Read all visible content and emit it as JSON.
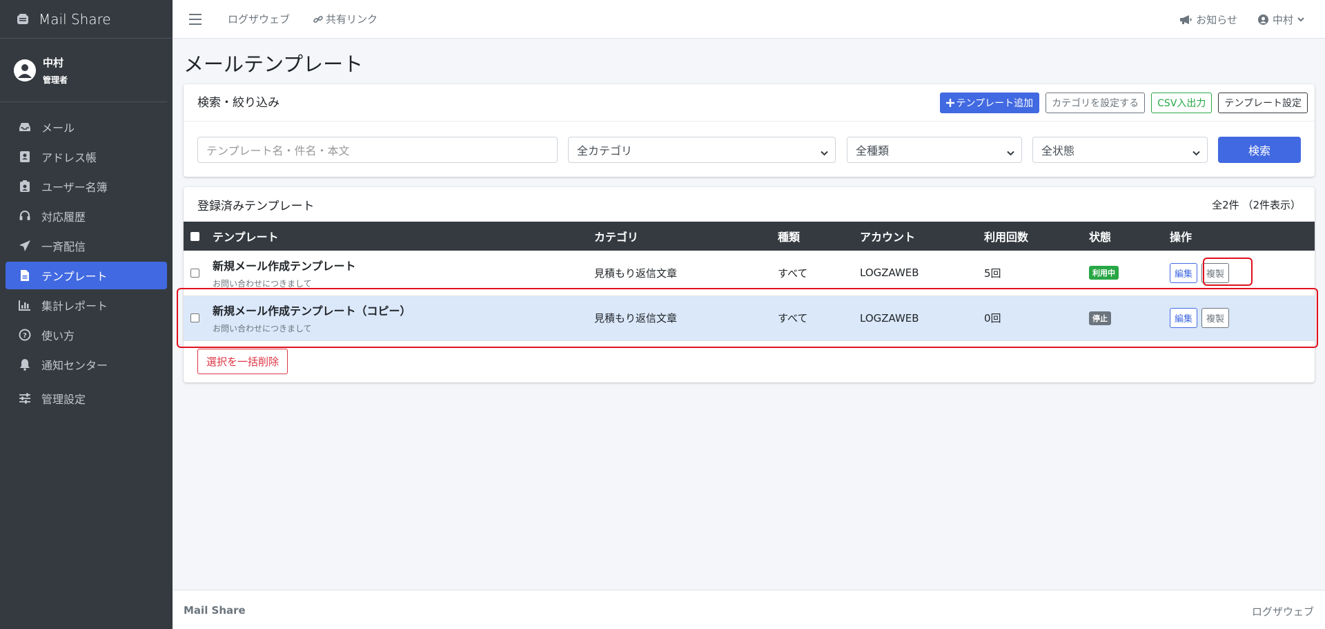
{
  "sidebar": {
    "brand": "Mail Share",
    "user": {
      "name": "中村",
      "role": "管理者"
    },
    "items": [
      {
        "label": "メール",
        "icon": "inbox-icon",
        "active": false
      },
      {
        "label": "アドレス帳",
        "icon": "address-book-icon",
        "active": false
      },
      {
        "label": "ユーザー名簿",
        "icon": "id-badge-icon",
        "active": false
      },
      {
        "label": "対応履歴",
        "icon": "headset-icon",
        "active": false
      },
      {
        "label": "一斉配信",
        "icon": "paper-plane-icon",
        "active": false
      },
      {
        "label": "テンプレート",
        "icon": "file-icon",
        "active": true
      },
      {
        "label": "集計レポート",
        "icon": "chart-bar-icon",
        "active": false
      },
      {
        "label": "使い方",
        "icon": "question-circle-icon",
        "active": false
      },
      {
        "label": "通知センター",
        "icon": "bell-icon",
        "active": false
      },
      {
        "label": "管理設定",
        "icon": "sliders-icon",
        "active": false
      }
    ]
  },
  "header": {
    "links": [
      "ログザウェブ",
      "共有リンク"
    ],
    "notice": "お知らせ",
    "user": "中村"
  },
  "page": {
    "title": "メールテンプレート"
  },
  "search": {
    "title": "検索・絞り込み",
    "buttons": {
      "add": "テンプレート追加",
      "category": "カテゴリを設定する",
      "csv": "CSV入出力",
      "settings": "テンプレート設定"
    },
    "placeholder": "テンプレート名・件名・本文",
    "category_select": "全カテゴリ",
    "type_select": "全種類",
    "status_select": "全状態",
    "submit": "検索"
  },
  "list": {
    "title": "登録済みテンプレート",
    "count": "全2件 （2件表示）",
    "columns": [
      "テンプレート",
      "カテゴリ",
      "種類",
      "アカウント",
      "利用回数",
      "状態",
      "操作"
    ],
    "rows": [
      {
        "name": "新規メール作成テンプレート",
        "subject": "お問い合わせにつきまして",
        "category": "見積もり返信文章",
        "type": "すべて",
        "account": "LOGZAWEB",
        "uses": "5回",
        "status": "利用中",
        "status_color": "#28a745",
        "edit": "編集",
        "copy": "複製"
      },
      {
        "name": "新規メール作成テンプレート（コピー）",
        "subject": "お問い合わせにつきまして",
        "category": "見積もり返信文章",
        "type": "すべて",
        "account": "LOGZAWEB",
        "uses": "0回",
        "status": "停止",
        "status_color": "#6c757d",
        "edit": "編集",
        "copy": "複製"
      }
    ],
    "bulk_delete": "選択を一括削除"
  },
  "footer": {
    "left": "Mail Share",
    "right": "ログザウェブ"
  },
  "colors": {
    "sidebar": "#343a40",
    "accent": "#4169e1",
    "highlight": "#e0101e"
  }
}
